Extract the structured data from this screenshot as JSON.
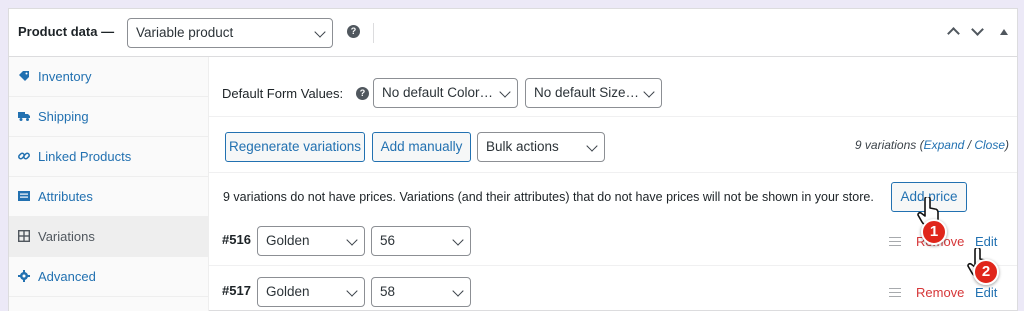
{
  "header": {
    "title": "Product data —",
    "product_type": "Variable product",
    "help": "?"
  },
  "sidebar": {
    "items": [
      {
        "label": "Inventory",
        "icon": "tag-icon"
      },
      {
        "label": "Shipping",
        "icon": "truck-icon"
      },
      {
        "label": "Linked Products",
        "icon": "link-icon"
      },
      {
        "label": "Attributes",
        "icon": "list-icon"
      },
      {
        "label": "Variations",
        "icon": "grid-icon",
        "active": true
      },
      {
        "label": "Advanced",
        "icon": "gear-icon"
      }
    ]
  },
  "defaults": {
    "label": "Default Form Values:",
    "help": "?",
    "color_select": "No default Color…",
    "size_select": "No default Size…"
  },
  "toolbar": {
    "regenerate": "Regenerate variations",
    "add_manually": "Add manually",
    "bulk_actions": "Bulk actions",
    "count_text": "9 variations (",
    "expand": "Expand",
    "slash": " / ",
    "close": "Close",
    "count_end": ")"
  },
  "notice": {
    "text": "9 variations do not have prices. Variations (and their attributes) that do not have prices will not be shown in your store.",
    "button": "Add price"
  },
  "variations": [
    {
      "id": "#516",
      "color": "Golden",
      "size": "56",
      "remove": "Remove",
      "edit": "Edit"
    },
    {
      "id": "#517",
      "color": "Golden",
      "size": "58",
      "remove": "Remove",
      "edit": "Edit"
    }
  ],
  "callouts": {
    "one": "1",
    "two": "2"
  },
  "colors": {
    "accent": "#2271b1",
    "danger": "#d63638",
    "callout": "#e0261b"
  }
}
